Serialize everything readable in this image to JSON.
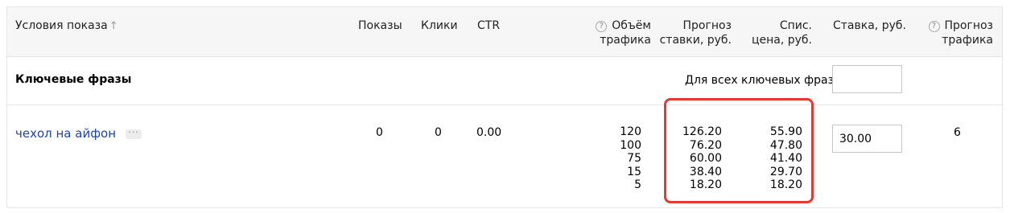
{
  "header": {
    "conditions": "Условия показа",
    "sort_arrow": "↑",
    "shows": "Показы",
    "clicks": "Клики",
    "ctr": "CTR",
    "traffic_volume_1": "Объём",
    "traffic_volume_2": "трафика",
    "forecast_bid_1": "Прогноз",
    "forecast_bid_2": "ставки, руб.",
    "charge_price_1": "Спис.",
    "charge_price_2": "цена, руб.",
    "bid": "Ставка, руб.",
    "traffic_forecast_1": "Прогноз",
    "traffic_forecast_2": "трафика",
    "help_icon_glyph": "?"
  },
  "group": {
    "title": "Ключевые фразы",
    "all_label": "Для всех ключевых фраз:",
    "all_input_value": ""
  },
  "row": {
    "phrase": "чехол на айфон",
    "more_icon_glyph": "···",
    "shows": "0",
    "clicks": "0",
    "ctr": "0.00",
    "traffic_volumes": [
      "120",
      "100",
      "75",
      "15",
      "5"
    ],
    "forecast_bids": [
      "126.20",
      "76.20",
      "60.00",
      "38.40",
      "18.20"
    ],
    "charge_prices": [
      "55.90",
      "47.80",
      "41.40",
      "29.70",
      "18.20"
    ],
    "bid_value": "30.00",
    "traffic_forecast": "6"
  },
  "colors": {
    "link": "#1d44a8",
    "highlight": "#e53935",
    "header_bg": "#f6f6f6"
  }
}
